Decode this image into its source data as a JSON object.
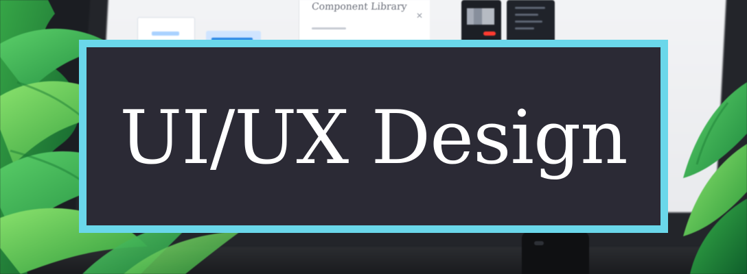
{
  "hero": {
    "title": "UI/UX Design",
    "accent_color": "#6ad7ea",
    "panel_color": "#2b2a35"
  },
  "background": {
    "screen_card_title": "Component Library"
  },
  "icons": {
    "plant": "plant-leaves",
    "monitor": "monitor",
    "stand": "monitor-stand"
  }
}
